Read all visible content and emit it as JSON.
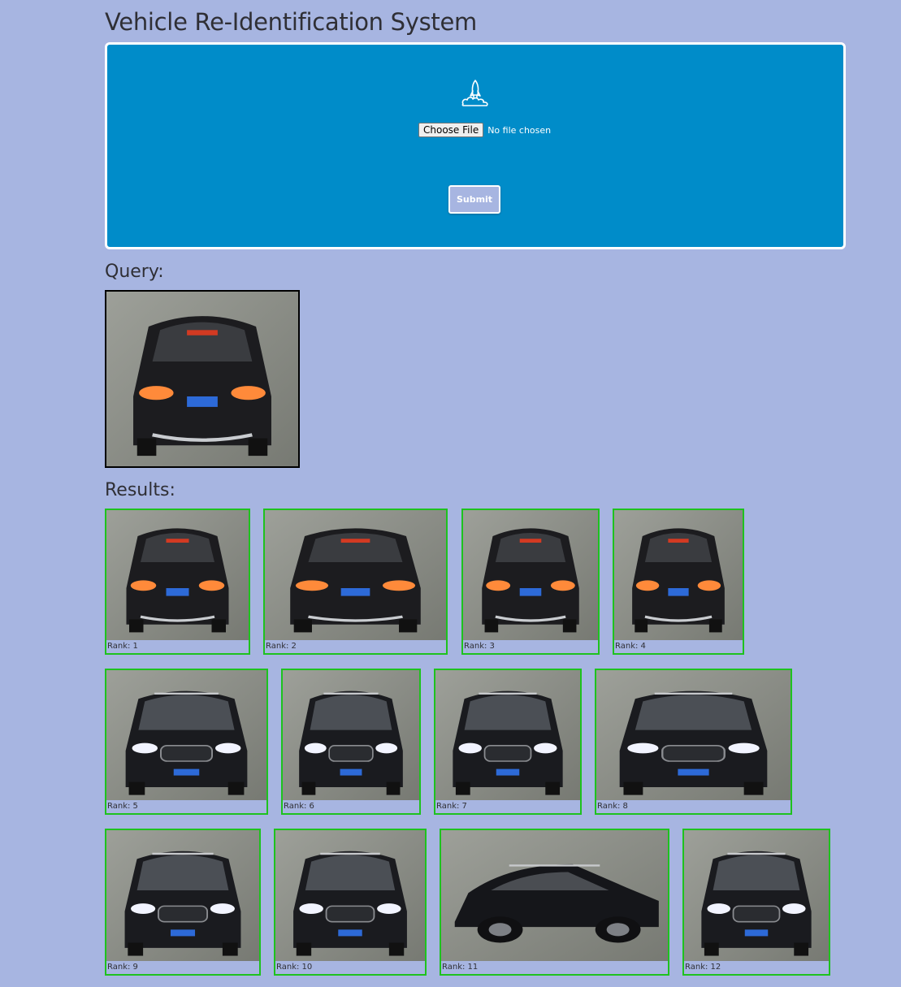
{
  "page": {
    "title": "Vehicle Re-Identification System"
  },
  "upload": {
    "icon": "rocket-cloud-icon",
    "choose_file_label": "Choose File",
    "file_status": "No file chosen",
    "submit_label": "Submit",
    "panel_color": "#008cc9",
    "background_color": "#a7b5e1"
  },
  "query": {
    "label": "Query:"
  },
  "results": {
    "label": "Results:",
    "match_border_color": "#1ec21e",
    "items": [
      {
        "rank": "Rank: 1",
        "view": "rear"
      },
      {
        "rank": "Rank: 2",
        "view": "rear-angle"
      },
      {
        "rank": "Rank: 3",
        "view": "rear-top"
      },
      {
        "rank": "Rank: 4",
        "view": "rear-top"
      },
      {
        "rank": "Rank: 5",
        "view": "front"
      },
      {
        "rank": "Rank: 6",
        "view": "front"
      },
      {
        "rank": "Rank: 7",
        "view": "front"
      },
      {
        "rank": "Rank: 8",
        "view": "front-angle"
      },
      {
        "rank": "Rank: 9",
        "view": "front"
      },
      {
        "rank": "Rank: 10",
        "view": "front"
      },
      {
        "rank": "Rank: 11",
        "view": "side"
      },
      {
        "rank": "Rank: 12",
        "view": "front"
      }
    ]
  }
}
